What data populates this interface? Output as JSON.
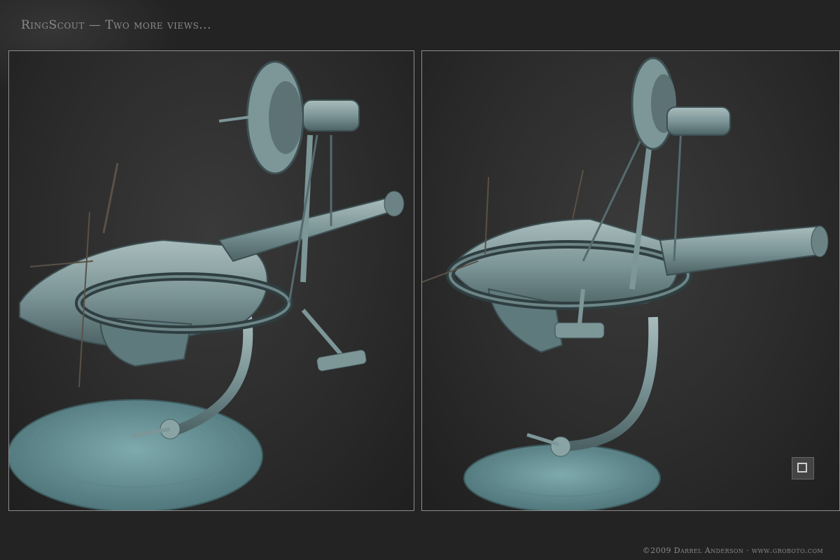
{
  "header": {
    "title": "RingScout — Two more views..."
  },
  "footer": {
    "copyright": "©2009 Darrel Anderson · www.groboto.com"
  },
  "colors": {
    "background": "#232323",
    "panel_border": "#8d8d8d",
    "model_metal": "#7f9a9c",
    "text": "#8a8a8a"
  },
  "views": [
    {
      "name": "view-left"
    },
    {
      "name": "view-right"
    }
  ]
}
